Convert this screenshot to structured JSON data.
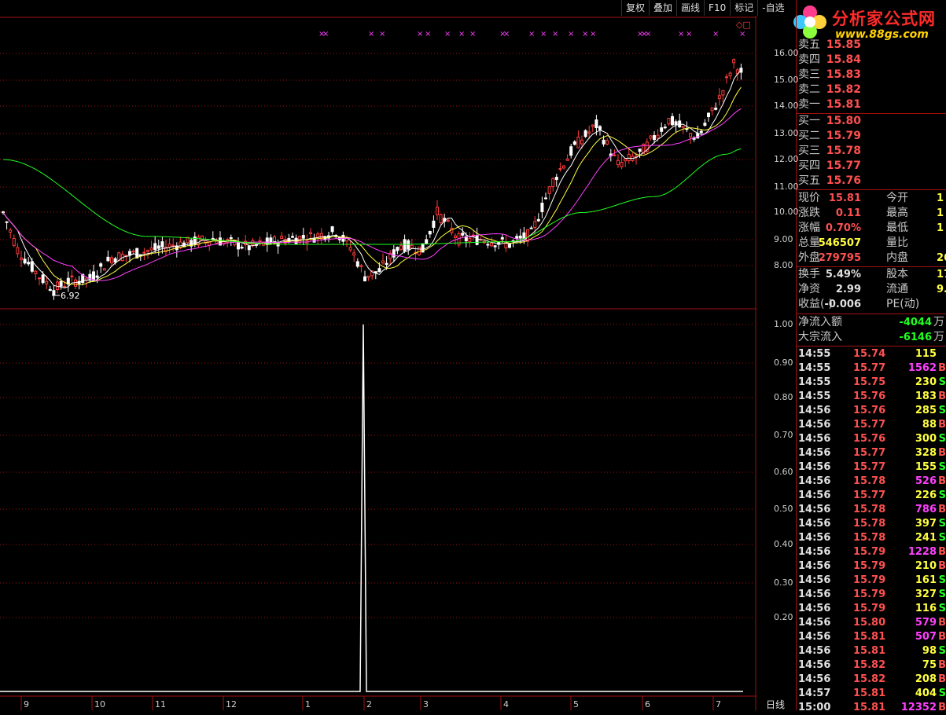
{
  "toolbar": [
    "复权",
    "叠加",
    "画线",
    "F10",
    "标记",
    "-自选"
  ],
  "logo": {
    "title": "分析家公式网",
    "url": "www.88gs.com"
  },
  "colors": {
    "up": "#ff3c3c",
    "down": "#ffffff",
    "ma5": "#ffffff",
    "ma10": "#ffff40",
    "ma20": "#ff40ff",
    "ma60": "#20ff20",
    "grid": "#a01010"
  },
  "price_axis": [
    "16.00",
    "15.00",
    "14.00",
    "13.00",
    "12.00",
    "11.00",
    "10.00",
    "9.00",
    "8.00"
  ],
  "indicator_axis": [
    "1.00",
    "0.90",
    "0.80",
    "0.70",
    "0.60",
    "0.50",
    "0.40",
    "0.30",
    "0.20"
  ],
  "x_labels": [
    "9",
    "10",
    "11",
    "12",
    "1",
    "2",
    "3",
    "4",
    "5",
    "6",
    "7"
  ],
  "low_marker": "6.92",
  "period": "日线",
  "order_book": {
    "sell": [
      {
        "label": "卖五",
        "price": "15.85"
      },
      {
        "label": "卖四",
        "price": "15.84"
      },
      {
        "label": "卖三",
        "price": "15.83"
      },
      {
        "label": "卖二",
        "price": "15.82"
      },
      {
        "label": "卖一",
        "price": "15.81"
      }
    ],
    "buy": [
      {
        "label": "买一",
        "price": "15.80"
      },
      {
        "label": "买二",
        "price": "15.79"
      },
      {
        "label": "买三",
        "price": "15.78"
      },
      {
        "label": "买四",
        "price": "15.77"
      },
      {
        "label": "买五",
        "price": "15.76"
      }
    ]
  },
  "quote": {
    "rows": [
      {
        "l1": "现价",
        "v1": "15.81",
        "c1": "red",
        "l2": "今开",
        "v2": "1"
      },
      {
        "l1": "涨跌",
        "v1": "0.11",
        "c1": "red",
        "l2": "最高",
        "v2": "1"
      },
      {
        "l1": "涨幅",
        "v1": "0.70%",
        "c1": "red",
        "l2": "最低",
        "v2": "1"
      },
      {
        "l1": "总量",
        "v1": "546507",
        "c1": "yel",
        "l2": "量比",
        "v2": ""
      },
      {
        "l1": "外盘",
        "v1": "279795",
        "c1": "red",
        "l2": "内盘",
        "v2": "26"
      }
    ],
    "rows2": [
      {
        "l1": "换手",
        "v1": "5.49%",
        "c1": "wht",
        "l2": "股本",
        "v2": "17"
      },
      {
        "l1": "净资",
        "v1": "2.99",
        "c1": "wht",
        "l2": "流通",
        "v2": "9."
      },
      {
        "l1": "收益(-)",
        "v1": "-0.006",
        "c1": "wht",
        "l2": "PE(动)",
        "v2": ""
      }
    ]
  },
  "flow": [
    {
      "label": "净流入额",
      "value": "-4044",
      "unit": "万"
    },
    {
      "label": "大宗流入",
      "value": "-6146",
      "unit": "万"
    }
  ],
  "ticks": [
    {
      "time": "14:55",
      "price": "15.74",
      "pc": "red",
      "vol": "115",
      "vc": "yel",
      "side": ""
    },
    {
      "time": "14:55",
      "price": "15.77",
      "pc": "red",
      "vol": "1562",
      "vc": "mag",
      "side": "B"
    },
    {
      "time": "14:55",
      "price": "15.75",
      "pc": "red",
      "vol": "230",
      "vc": "yel",
      "side": "S"
    },
    {
      "time": "14:55",
      "price": "15.76",
      "pc": "red",
      "vol": "183",
      "vc": "yel",
      "side": "B"
    },
    {
      "time": "14:56",
      "price": "15.76",
      "pc": "red",
      "vol": "285",
      "vc": "yel",
      "side": "S"
    },
    {
      "time": "14:56",
      "price": "15.77",
      "pc": "red",
      "vol": "88",
      "vc": "yel",
      "side": "B"
    },
    {
      "time": "14:56",
      "price": "15.76",
      "pc": "red",
      "vol": "300",
      "vc": "yel",
      "side": "S"
    },
    {
      "time": "14:56",
      "price": "15.77",
      "pc": "red",
      "vol": "328",
      "vc": "yel",
      "side": "B"
    },
    {
      "time": "14:56",
      "price": "15.77",
      "pc": "red",
      "vol": "155",
      "vc": "yel",
      "side": "S"
    },
    {
      "time": "14:56",
      "price": "15.78",
      "pc": "red",
      "vol": "526",
      "vc": "mag",
      "side": "B"
    },
    {
      "time": "14:56",
      "price": "15.77",
      "pc": "red",
      "vol": "226",
      "vc": "yel",
      "side": "S"
    },
    {
      "time": "14:56",
      "price": "15.78",
      "pc": "red",
      "vol": "786",
      "vc": "mag",
      "side": "B"
    },
    {
      "time": "14:56",
      "price": "15.78",
      "pc": "red",
      "vol": "397",
      "vc": "yel",
      "side": "S"
    },
    {
      "time": "14:56",
      "price": "15.78",
      "pc": "red",
      "vol": "241",
      "vc": "yel",
      "side": "S"
    },
    {
      "time": "14:56",
      "price": "15.79",
      "pc": "red",
      "vol": "1228",
      "vc": "mag",
      "side": "B"
    },
    {
      "time": "14:56",
      "price": "15.79",
      "pc": "red",
      "vol": "210",
      "vc": "yel",
      "side": "B"
    },
    {
      "time": "14:56",
      "price": "15.79",
      "pc": "red",
      "vol": "161",
      "vc": "yel",
      "side": "S"
    },
    {
      "time": "14:56",
      "price": "15.79",
      "pc": "red",
      "vol": "327",
      "vc": "yel",
      "side": "S"
    },
    {
      "time": "14:56",
      "price": "15.79",
      "pc": "red",
      "vol": "116",
      "vc": "yel",
      "side": "S"
    },
    {
      "time": "14:56",
      "price": "15.80",
      "pc": "red",
      "vol": "579",
      "vc": "mag",
      "side": "B"
    },
    {
      "time": "14:56",
      "price": "15.81",
      "pc": "red",
      "vol": "507",
      "vc": "mag",
      "side": "B"
    },
    {
      "time": "14:56",
      "price": "15.81",
      "pc": "red",
      "vol": "98",
      "vc": "yel",
      "side": "S"
    },
    {
      "time": "14:56",
      "price": "15.82",
      "pc": "red",
      "vol": "75",
      "vc": "yel",
      "side": "B"
    },
    {
      "time": "14:56",
      "price": "15.82",
      "pc": "red",
      "vol": "208",
      "vc": "yel",
      "side": "B"
    },
    {
      "time": "14:57",
      "price": "15.81",
      "pc": "red",
      "vol": "404",
      "vc": "yel",
      "side": "S"
    },
    {
      "time": "15:00",
      "price": "15.81",
      "pc": "red",
      "vol": "12352",
      "vc": "mag",
      "side": "B"
    }
  ]
}
